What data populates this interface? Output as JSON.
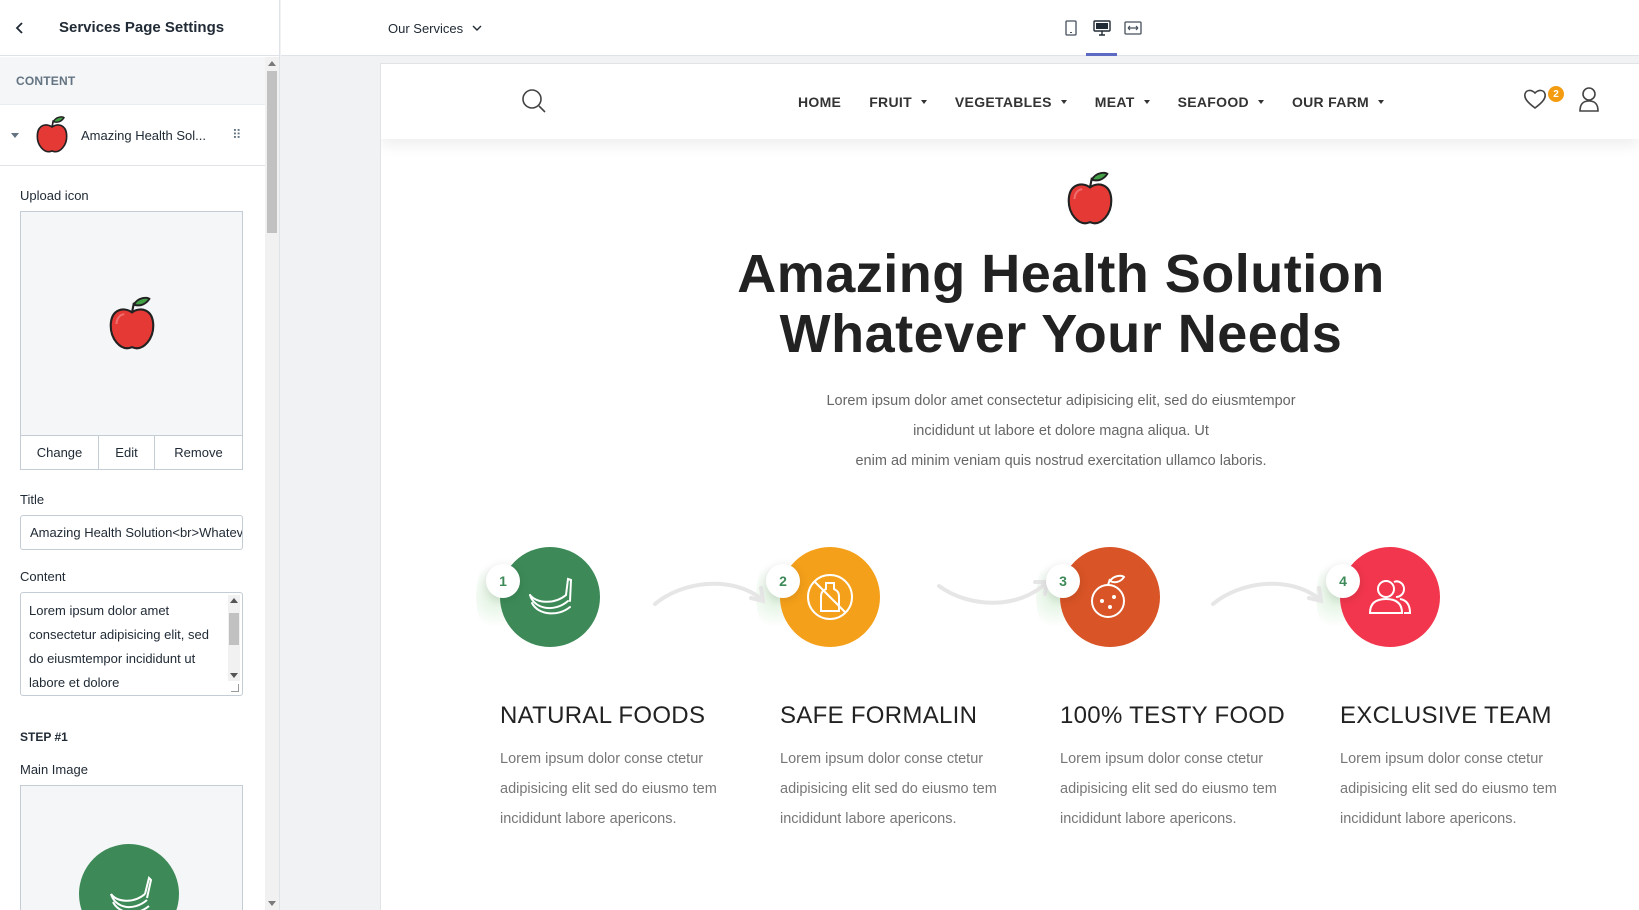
{
  "panel": {
    "title": "Services Page Settings",
    "section_label": "CONTENT",
    "block_name": "Amazing Health Sol...",
    "upload_icon_label": "Upload icon",
    "image_actions": {
      "change": "Change",
      "edit": "Edit",
      "remove": "Remove"
    },
    "title_label": "Title",
    "title_value": "Amazing Health Solution<br>Whatever Your Needs",
    "content_label": "Content",
    "content_value": "Lorem ipsum dolor amet consectetur adipisicing elit, sed do eiusmtempor incididunt ut labore et dolore",
    "step_label": "STEP #1",
    "main_image_label": "Main Image"
  },
  "topbar": {
    "page_select": "Our Services",
    "device_icons": [
      "mobile-icon",
      "desktop-icon",
      "fullscreen-icon"
    ],
    "active_device": "desktop"
  },
  "site": {
    "menu": [
      {
        "label": "HOME",
        "dropdown": false
      },
      {
        "label": "FRUIT",
        "dropdown": true
      },
      {
        "label": "VEGETABLES",
        "dropdown": true
      },
      {
        "label": "MEAT",
        "dropdown": true
      },
      {
        "label": "SEAFOOD",
        "dropdown": true
      },
      {
        "label": "OUR FARM",
        "dropdown": true
      }
    ],
    "wishlist_count": "2",
    "hero": {
      "title_line1": "Amazing Health Solution",
      "title_line2": "Whatever Your Needs",
      "text_line1": "Lorem ipsum dolor amet consectetur adipisicing elit, sed do eiusmtempor",
      "text_line2": "incididunt ut labore et dolore magna aliqua. Ut",
      "text_line3": "enim ad minim veniam quis nostrud exercitation ullamco laboris."
    },
    "steps": [
      {
        "num": "1",
        "title": "NATURAL FOODS",
        "text": "Lorem ipsum dolor conse ctetur adipisicing elit sed do eiusmo tem incididunt labore apericons.",
        "color": "#3d8a58",
        "icon": "banana-icon"
      },
      {
        "num": "2",
        "title": "SAFE FORMALIN",
        "text": "Lorem ipsum dolor conse ctetur adipisicing elit sed do eiusmo tem incididunt labore apericons.",
        "color": "#f5a01a",
        "icon": "no-bottle-icon"
      },
      {
        "num": "3",
        "title": "100% TESTY FOOD",
        "text": "Lorem ipsum dolor conse ctetur adipisicing elit sed do eiusmo tem incididunt labore apericons.",
        "color": "#d95426",
        "icon": "orange-icon"
      },
      {
        "num": "4",
        "title": "EXCLUSIVE TEAM",
        "text": "Lorem ipsum dolor conse ctetur adipisicing elit sed do eiusmo tem incididunt labore apericons.",
        "color": "#f2364d",
        "icon": "team-icon"
      }
    ]
  },
  "colors": {
    "accent": "#5c6ac4",
    "apple_red": "#e53935",
    "leaf_green": "#43a047"
  }
}
